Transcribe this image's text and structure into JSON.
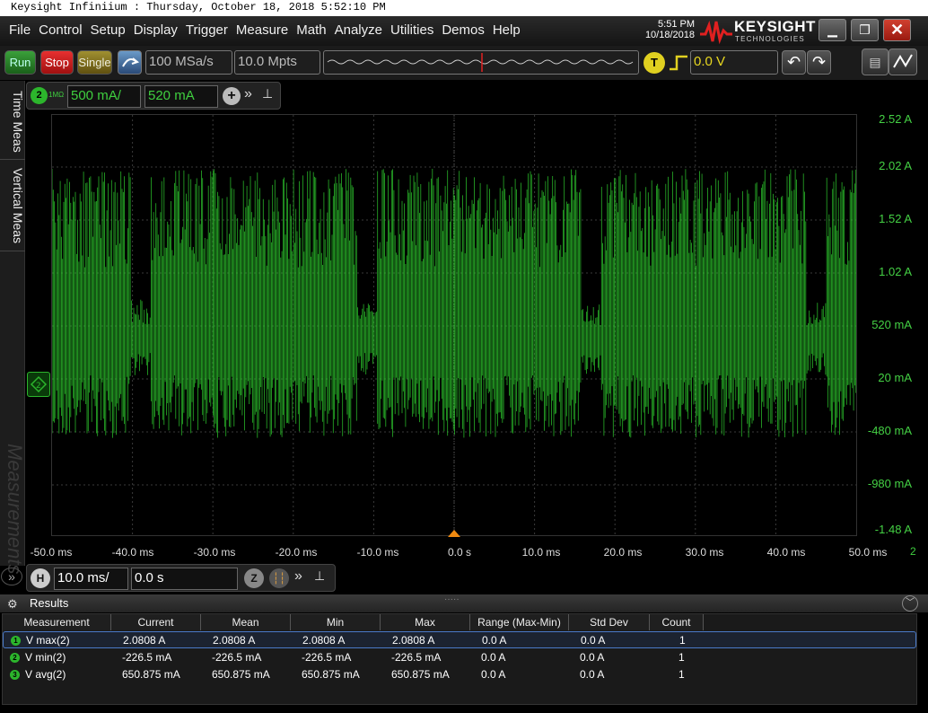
{
  "window": {
    "title": "Keysight Infiniium : Thursday, October 18, 2018 5:52:10 PM"
  },
  "menu": [
    "File",
    "Control",
    "Setup",
    "Display",
    "Trigger",
    "Measure",
    "Math",
    "Analyze",
    "Utilities",
    "Demos",
    "Help"
  ],
  "clock": {
    "time": "5:51 PM",
    "date": "10/18/2018"
  },
  "brand": {
    "name": "KEYSIGHT",
    "sub": "TECHNOLOGIES"
  },
  "toolbar": {
    "run": "Run",
    "stop": "Stop",
    "single": "Single",
    "sample_rate": "100 MSa/s",
    "memory_depth": "10.0 Mpts",
    "trigger_badge": "T",
    "trigger_level": "0.0 V"
  },
  "channel": {
    "number": "2",
    "impedance": "1MΩ",
    "scale": "500 mA/",
    "offset": "520 mA"
  },
  "side_tabs": [
    "Time Meas",
    "Vertical Meas"
  ],
  "side_watermark": "Measurements",
  "y_axis": [
    "2.52 A",
    "2.02 A",
    "1.52 A",
    "1.02 A",
    "520 mA",
    "20 mA",
    "-480 mA",
    "-980 mA",
    "-1.48 A"
  ],
  "x_axis": [
    "-50.0 ms",
    "-40.0 ms",
    "-30.0 ms",
    "-20.0 ms",
    "-10.0 ms",
    "0.0 s",
    "10.0 ms",
    "20.0 ms",
    "30.0 ms",
    "40.0 ms",
    "50.0 ms"
  ],
  "x_axis_suffix": "2",
  "horizontal": {
    "badge": "H",
    "scale": "10.0 ms/",
    "position": "0.0 s",
    "zoom_badge": "Z"
  },
  "results": {
    "title": "Results",
    "columns": [
      "Measurement",
      "Current",
      "Mean",
      "Min",
      "Max",
      "Range (Max-Min)",
      "Std Dev",
      "Count"
    ],
    "rows": [
      {
        "marker": "1",
        "name": "V max(2)",
        "current": "2.0808 A",
        "mean": "2.0808 A",
        "min": "2.0808 A",
        "max": "2.0808 A",
        "range": "0.0 A",
        "std": "0.0 A",
        "count": "1"
      },
      {
        "marker": "2",
        "name": "V min(2)",
        "current": "-226.5 mA",
        "mean": "-226.5 mA",
        "min": "-226.5 mA",
        "max": "-226.5 mA",
        "range": "0.0 A",
        "std": "0.0 A",
        "count": "1"
      },
      {
        "marker": "3",
        "name": "V avg(2)",
        "current": "650.875 mA",
        "mean": "650.875 mA",
        "min": "650.875 mA",
        "max": "650.875 mA",
        "range": "0.0 A",
        "std": "0.0 A",
        "count": "1"
      }
    ]
  },
  "colors": {
    "trace": "#2fd12f",
    "run": "#2a8a2a",
    "stop": "#d02020",
    "single": "#8a7a20",
    "grid": "#3a3a3a"
  }
}
